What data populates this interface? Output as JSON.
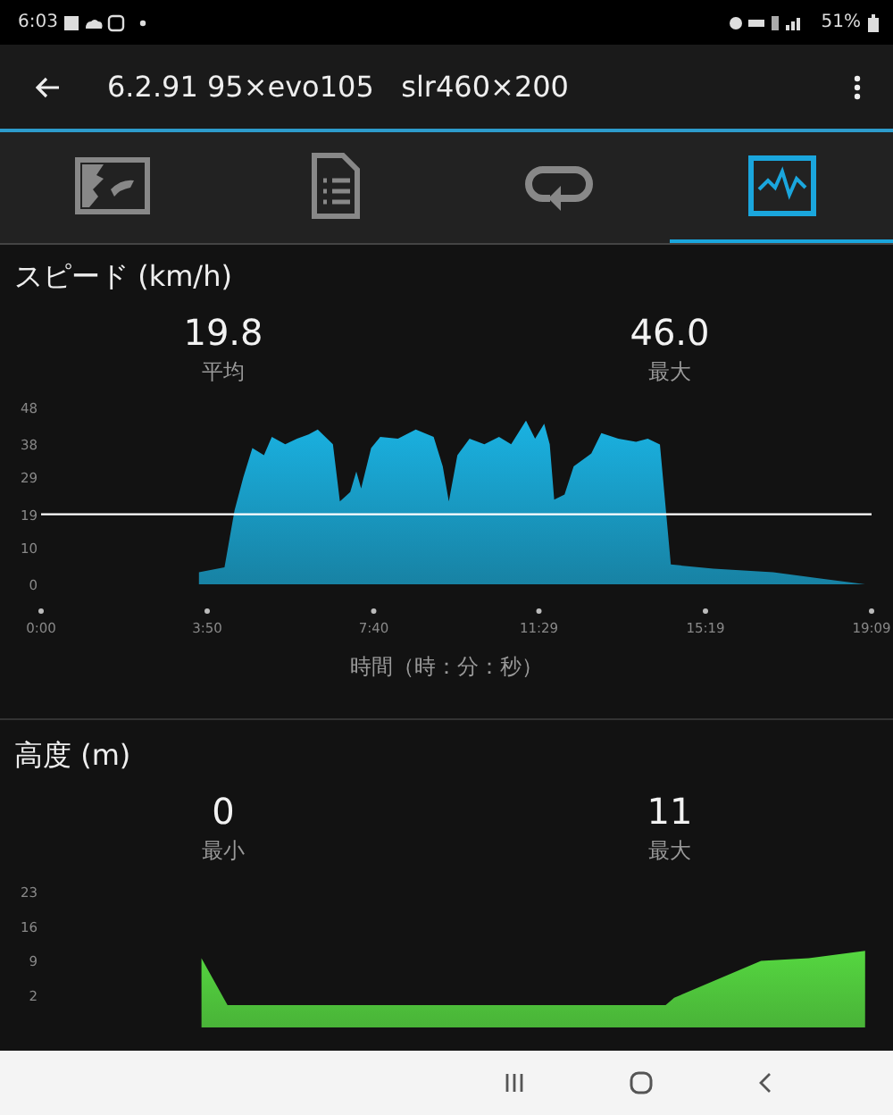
{
  "status_bar": {
    "time": "6:03",
    "battery": "51%"
  },
  "app_bar": {
    "title": "6.2.91 95×evo105   slr460×200"
  },
  "tabs": [
    {
      "selected": false
    },
    {
      "selected": false
    },
    {
      "selected": false
    },
    {
      "selected": true
    }
  ],
  "sections": [
    {
      "title": "スピード (km/h)",
      "stats": [
        {
          "value": "19.8",
          "label": "平均"
        },
        {
          "value": "46.0",
          "label": "最大"
        }
      ],
      "chart_data": {
        "type": "area",
        "xlabel": "時間（時：分：秒）",
        "x": [
          3.64,
          4.23,
          4.46,
          4.66,
          4.87,
          5.14,
          5.32,
          5.63,
          5.9,
          6.17,
          6.38,
          6.73,
          6.89,
          7.13,
          7.27,
          7.38,
          7.61,
          7.82,
          8.23,
          8.64,
          9.05,
          9.26,
          9.4,
          9.6,
          9.88,
          10.22,
          10.56,
          10.84,
          11.18,
          11.39,
          11.6,
          11.73,
          11.83,
          12.07,
          12.28,
          12.69,
          12.92,
          13.31,
          13.72,
          13.99,
          14.27,
          14.52,
          15.5,
          16.88,
          17.97,
          19.0
        ],
        "series": [
          {
            "color": "#1ab2e2",
            "values": [
              3.3,
              4.6,
              20,
              29,
              37,
              35,
              40,
              38,
              39.5,
              40.7,
              42,
              38,
              22.5,
              25,
              30.6,
              26,
              37,
              40,
              39.5,
              42,
              40,
              32,
              22.5,
              35,
              39.5,
              38,
              40,
              38,
              44.4,
              39.5,
              43.6,
              38,
              23,
              24.4,
              32,
              35.5,
              41,
              39.5,
              38.7,
              39.5,
              37.9,
              5.4,
              4.2,
              3.3,
              1.6,
              0
            ]
          }
        ],
        "xlim": [
          0,
          19.15
        ],
        "ylim": [
          0,
          48
        ],
        "yticks": [
          48,
          38,
          29,
          19,
          10,
          0
        ],
        "xticks": [
          {
            "value": 0,
            "label": "0:00"
          },
          {
            "value": 3.83,
            "label": "3:50"
          },
          {
            "value": 7.67,
            "label": "7:40"
          },
          {
            "value": 11.48,
            "label": "11:29"
          },
          {
            "value": 15.32,
            "label": "15:19"
          },
          {
            "value": 19.15,
            "label": "19:09"
          }
        ],
        "ref_lines": [
          {
            "axis": "y",
            "value": 19
          }
        ]
      }
    },
    {
      "title": "高度 (m)",
      "stats": [
        {
          "value": "0",
          "label": "最小"
        },
        {
          "value": "11",
          "label": "最大"
        }
      ],
      "chart_data": {
        "type": "area",
        "x": [
          3.7,
          4.3,
          14.4,
          14.6,
          16.6,
          17.7,
          19.0
        ],
        "series": [
          {
            "color": "#55d640",
            "values": [
              9.5,
              0,
              0,
              1.5,
              9,
              9.5,
              11
            ]
          }
        ],
        "xlim": [
          0,
          19.15
        ],
        "ylim": [
          0,
          23
        ],
        "yticks": [
          23,
          16,
          9,
          2
        ]
      }
    }
  ]
}
